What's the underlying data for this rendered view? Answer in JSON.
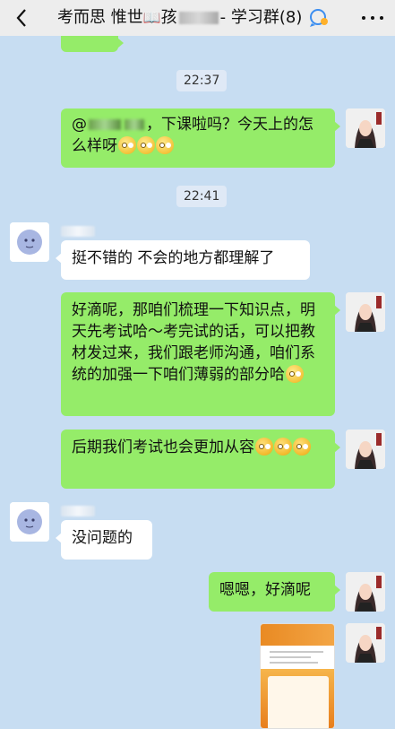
{
  "header": {
    "title_part1": "考而思 惟世",
    "title_part2": "孩",
    "title_part3": "- 学习群(8)"
  },
  "timestamps": [
    "22:37",
    "22:41"
  ],
  "messages": [
    {
      "side": "out",
      "text_before": "@",
      "text_after": "，下课啦吗？今天上的怎么样呀"
    },
    {
      "side": "in",
      "text": "挺不错的 不会的地方都理解了"
    },
    {
      "side": "out",
      "text": "好滴呢，那咱们梳理一下知识点，明天先考试哈～考完试的话，可以把教材发过来，我们跟老师沟通，咱们系统的加强一下咱们薄弱的部分哈"
    },
    {
      "side": "out",
      "text": "后期我们考试也会更加从容"
    },
    {
      "side": "in",
      "text": "没问题的"
    },
    {
      "side": "out",
      "text": "嗯嗯，好滴呢"
    }
  ],
  "icons": {
    "back": "chevron-left-icon",
    "group_call": "people-chat-icon",
    "more": "more-dots-icon",
    "emoji_smile": "shy-smile-emoji",
    "emoji_hug": "hug-emoji"
  },
  "colors": {
    "outgoing_bubble": "#95ec69",
    "incoming_bubble": "#ffffff",
    "background": "#c7ddf2",
    "header": "#ededed"
  }
}
